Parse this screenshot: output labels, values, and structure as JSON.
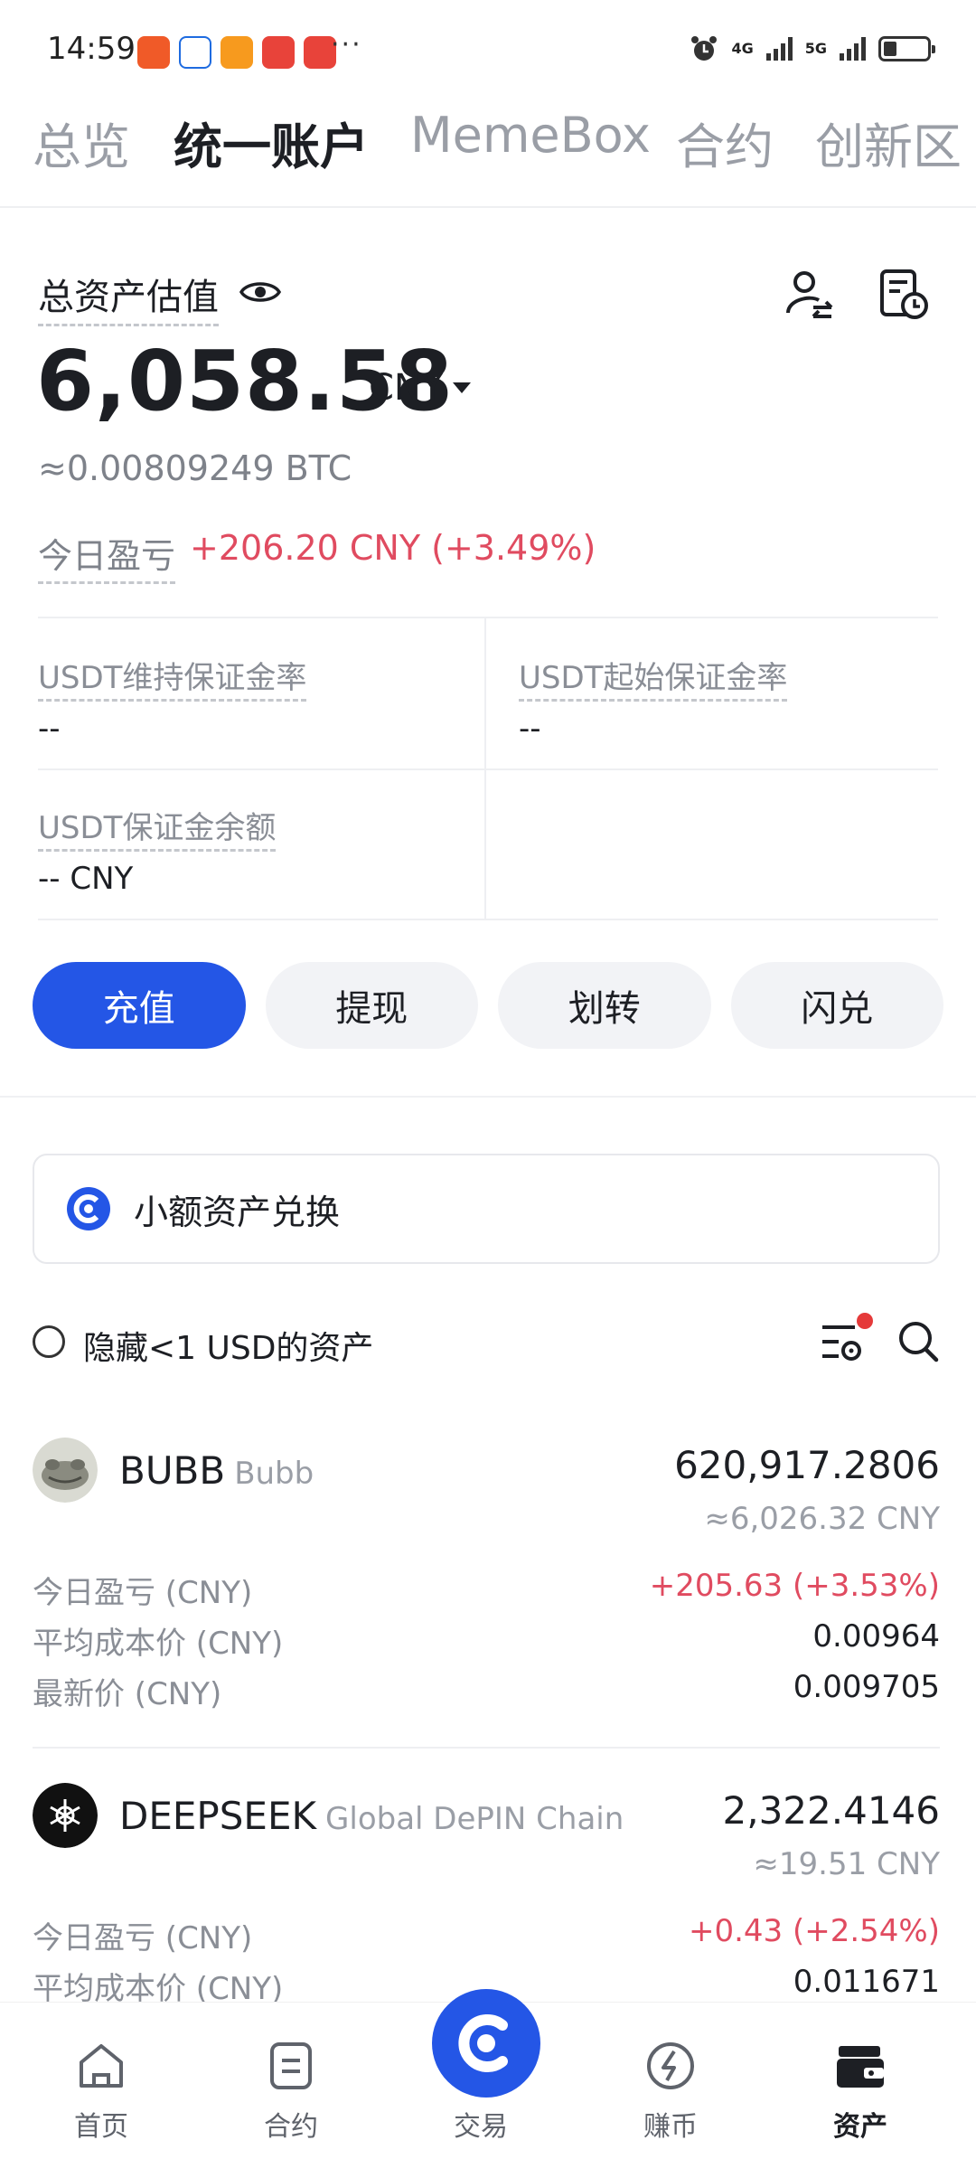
{
  "status_bar": {
    "time": "14:59",
    "more": "···",
    "net1": "4G",
    "net2": "5G",
    "battery_level": 0.3
  },
  "top_tabs": [
    "总览",
    "统一账户",
    "MemeBox",
    "合约",
    "创新区"
  ],
  "active_tab_index": 1,
  "summary": {
    "label": "总资产估值",
    "total": "6,058.58",
    "currency": "CNY",
    "btc_equiv": "≈0.00809249  BTC",
    "pnl_label": "今日盈亏",
    "pnl_value": "+206.20 CNY (+3.49%)"
  },
  "margin": {
    "maint_label": "USDT维持保证金率",
    "maint_value": "--",
    "initial_label": "USDT起始保证金率",
    "initial_value": "--",
    "balance_label": "USDT保证金余额",
    "balance_value": "-- CNY"
  },
  "actions": {
    "deposit": "充值",
    "withdraw": "提现",
    "transfer": "划转",
    "convert": "闪兑"
  },
  "small_convert": {
    "label": "小额资产兑换"
  },
  "filter": {
    "hide_small": "隐藏<1 USD的资产"
  },
  "assets": [
    {
      "symbol": "BUBB",
      "name": "Bubb",
      "amount": "620,917.2806",
      "cny": "≈6,026.32 CNY",
      "pnl_label": "今日盈亏 (CNY)",
      "pnl": "+205.63 (+3.53%)",
      "avg_label": "平均成本价 (CNY)",
      "avg": "0.00964",
      "last_label": "最新价 (CNY)",
      "last": "0.009705"
    },
    {
      "symbol": "DEEPSEEK",
      "name": "Global DePIN Chain",
      "amount": "2,322.4146",
      "cny": "≈19.51 CNY",
      "pnl_label": "今日盈亏 (CNY)",
      "pnl": "+0.43 (+2.54%)",
      "avg_label": "平均成本价 (CNY)",
      "avg": "0.011671"
    }
  ],
  "bottom_nav": {
    "home": "首页",
    "futures": "合约",
    "trade": "交易",
    "earn": "赚币",
    "assets": "资产"
  },
  "colors": {
    "accent": "#2456e6",
    "up": "#e04b60",
    "muted": "#8a8e96"
  }
}
